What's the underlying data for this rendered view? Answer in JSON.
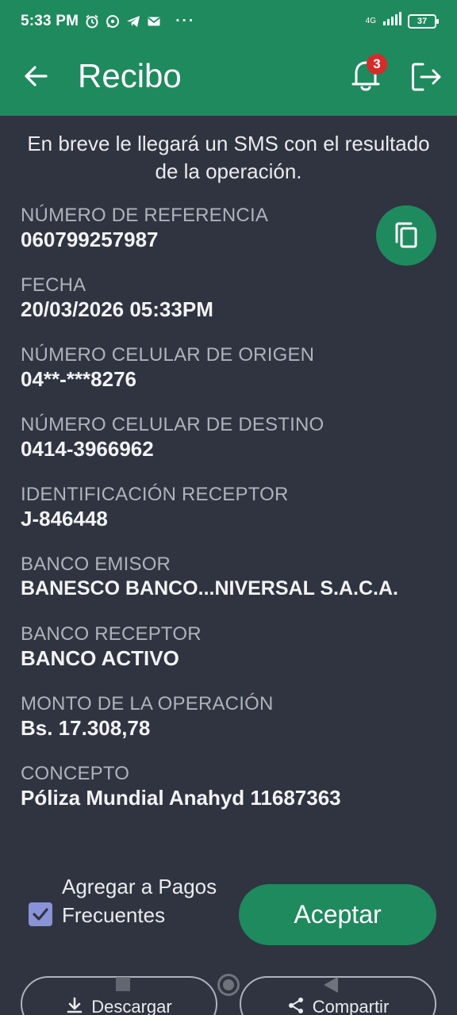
{
  "status_bar": {
    "time": "5:33 PM",
    "icons": [
      "alarm-icon",
      "whatsapp-icon",
      "telegram-icon",
      "mail-icon"
    ],
    "more": "···",
    "network": "4G",
    "battery": "37"
  },
  "app_bar": {
    "title": "Recibo",
    "notification_count": "3"
  },
  "message": "En breve le llegará un SMS con el resultado de la operación.",
  "receipt": {
    "reference_label": "NÚMERO DE REFERENCIA",
    "reference_value": "060799257987",
    "date_label": "FECHA",
    "date_value": "20/03/2026 05:33PM",
    "origin_label": "NÚMERO CELULAR DE ORIGEN",
    "origin_value": "04**-***8276",
    "destination_label": "NÚMERO CELULAR DE DESTINO",
    "destination_value": "0414-3966962",
    "receiver_id_label": "IDENTIFICACIÓN RECEPTOR",
    "receiver_id_value": "J-846448",
    "issuing_bank_label": "BANCO EMISOR",
    "issuing_bank_value": "BANESCO BANCO...NIVERSAL S.A.C.A.",
    "receiving_bank_label": "BANCO RECEPTOR",
    "receiving_bank_value": "BANCO ACTIVO",
    "amount_label": "MONTO DE LA OPERACIÓN",
    "amount_value": "Bs. 17.308,78",
    "concept_label": "CONCEPTO",
    "concept_value": "Póliza Mundial Anahyd 11687363"
  },
  "actions": {
    "add_frequent_label": "Agregar a Pagos Frecuentes",
    "add_frequent_checked": true,
    "accept_label": "Aceptar",
    "download_label": "Descargar",
    "share_label": "Compartir"
  },
  "colors": {
    "primary": "#1f8a5e",
    "background": "#2f3440",
    "badge": "#d52b2b",
    "checkbox": "#8a93d8"
  }
}
